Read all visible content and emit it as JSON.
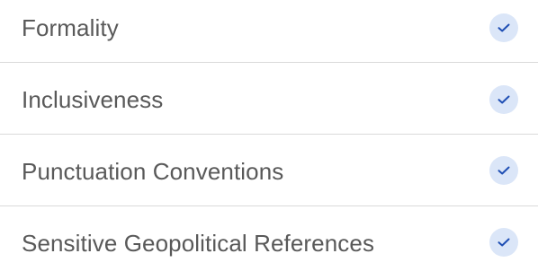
{
  "accent_color": "#1f4fb4",
  "check_bg_color": "#dbe6f8",
  "items": [
    {
      "label": "Formality",
      "checked": true,
      "icon": "checkmark-icon"
    },
    {
      "label": "Inclusiveness",
      "checked": true,
      "icon": "checkmark-icon"
    },
    {
      "label": "Punctuation Conventions",
      "checked": true,
      "icon": "checkmark-icon"
    },
    {
      "label": "Sensitive Geopolitical References",
      "checked": true,
      "icon": "checkmark-icon"
    }
  ]
}
